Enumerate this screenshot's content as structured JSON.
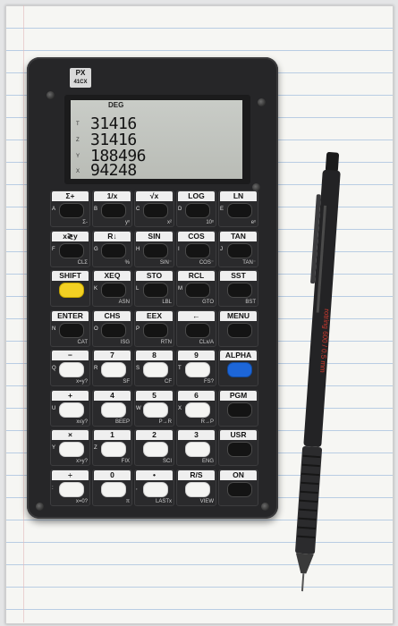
{
  "brand": {
    "logo_top": "PX",
    "logo_bottom": "41CX"
  },
  "display": {
    "annunciator": "DEG",
    "registers": [
      {
        "name": "T",
        "value": "31416"
      },
      {
        "name": "Z",
        "value": "31416"
      },
      {
        "name": "Y",
        "value": "188496"
      },
      {
        "name": "X",
        "value": "94248"
      }
    ]
  },
  "keys": [
    {
      "f": "Σ+",
      "l": "A",
      "g": "Σ-",
      "cap": "black"
    },
    {
      "f": "1/x",
      "l": "B",
      "g": "yˣ",
      "cap": "black"
    },
    {
      "f": "√x",
      "l": "C",
      "g": "x²",
      "cap": "black"
    },
    {
      "f": "LOG",
      "l": "D",
      "g": "10ˣ",
      "cap": "black"
    },
    {
      "f": "LN",
      "l": "E",
      "g": "eˣ",
      "cap": "black"
    },
    {
      "f": "x≷y",
      "l": "F",
      "g": "CLΣ",
      "cap": "black"
    },
    {
      "f": "R↓",
      "l": "G",
      "g": "%",
      "cap": "black"
    },
    {
      "f": "SIN",
      "l": "H",
      "g": "SIN⁻",
      "cap": "black"
    },
    {
      "f": "COS",
      "l": "I",
      "g": "COS⁻",
      "cap": "black"
    },
    {
      "f": "TAN",
      "l": "J",
      "g": "TAN⁻",
      "cap": "black"
    },
    {
      "f": "SHIFT",
      "l": "",
      "g": "",
      "cap": "yellow"
    },
    {
      "f": "XEQ",
      "l": "K",
      "g": "ASN",
      "cap": "black"
    },
    {
      "f": "STO",
      "l": "L",
      "g": "LBL",
      "cap": "black"
    },
    {
      "f": "RCL",
      "l": "M",
      "g": "GTO",
      "cap": "black"
    },
    {
      "f": "SST",
      "l": "",
      "g": "BST",
      "cap": "black"
    },
    {
      "f": "ENTER",
      "l": "N",
      "g": "CAT",
      "cap": "black"
    },
    {
      "f": "CHS",
      "l": "O",
      "g": "ISG",
      "cap": "black"
    },
    {
      "f": "EEX",
      "l": "P",
      "g": "RTN",
      "cap": "black"
    },
    {
      "f": "←",
      "l": "",
      "g": "CLx/A",
      "cap": "black"
    },
    {
      "f": "MENU",
      "l": "",
      "g": "",
      "cap": "black"
    },
    {
      "f": "−",
      "l": "Q",
      "g": "x=y?",
      "cap": "white"
    },
    {
      "f": "7",
      "l": "R",
      "g": "SF",
      "cap": "white"
    },
    {
      "f": "8",
      "l": "S",
      "g": "CF",
      "cap": "white"
    },
    {
      "f": "9",
      "l": "T",
      "g": "FS?",
      "cap": "white"
    },
    {
      "f": "ALPHA",
      "l": "",
      "g": "",
      "cap": "blue"
    },
    {
      "f": "+",
      "l": "U",
      "g": "x≤y?",
      "cap": "white"
    },
    {
      "f": "4",
      "l": "",
      "g": "BEEP",
      "cap": "white"
    },
    {
      "f": "5",
      "l": "W",
      "g": "P→R",
      "cap": "white"
    },
    {
      "f": "6",
      "l": "X",
      "g": "R→P",
      "cap": "white"
    },
    {
      "f": "PGM",
      "l": "",
      "g": "",
      "cap": "black"
    },
    {
      "f": "×",
      "l": "Y",
      "g": "x>y?",
      "cap": "white"
    },
    {
      "f": "1",
      "l": "Z",
      "g": "FIX",
      "cap": "white"
    },
    {
      "f": "2",
      "l": "",
      "g": "SCI",
      "cap": "white"
    },
    {
      "f": "3",
      "l": "",
      "g": "ENG",
      "cap": "white"
    },
    {
      "f": "USR",
      "l": "",
      "g": "",
      "cap": "black"
    },
    {
      "f": "÷",
      "l": ":",
      "g": "x=0?",
      "cap": "white"
    },
    {
      "f": "0",
      "l": "",
      "g": "π",
      "cap": "white"
    },
    {
      "f": "•",
      "l": ",",
      "g": "LASTx",
      "cap": "white"
    },
    {
      "f": "R/S",
      "l": "",
      "g": "VIEW",
      "cap": "white"
    },
    {
      "f": "ON",
      "l": "",
      "g": "",
      "cap": "black"
    }
  ],
  "pencil": {
    "brand_text": "rotring 600 / 0.5 mm"
  }
}
